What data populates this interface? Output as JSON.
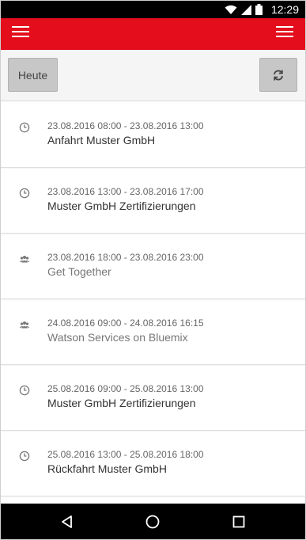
{
  "status": {
    "time": "12:29",
    "icons": [
      "wifi-icon",
      "signal-icon",
      "battery-icon"
    ]
  },
  "appbar": {
    "color": "#e30d1c",
    "left_icon": "hamburger-menu-icon",
    "right_icon": "hamburger-menu-icon"
  },
  "toolbar": {
    "today_label": "Heute",
    "refresh_icon": "refresh-icon"
  },
  "events": [
    {
      "range": "23.08.2016 08:00 - 23.08.2016 13:00",
      "title": "Anfahrt Muster GmbH",
      "icon": "clock-icon"
    },
    {
      "range": "23.08.2016 13:00 - 23.08.2016 17:00",
      "title": "Muster GmbH Zertifizierungen",
      "icon": "clock-icon"
    },
    {
      "range": "23.08.2016 18:00 - 23.08.2016 23:00",
      "title": "Get Together",
      "icon": "group-icon"
    },
    {
      "range": "24.08.2016 09:00 - 24.08.2016 16:15",
      "title": "Watson Services on Bluemix",
      "icon": "group-icon"
    },
    {
      "range": "25.08.2016 09:00 - 25.08.2016 13:00",
      "title": "Muster GmbH Zertifizierungen",
      "icon": "clock-icon"
    },
    {
      "range": "25.08.2016 13:00 - 25.08.2016 18:00",
      "title": "Rückfahrt Muster GmbH",
      "icon": "clock-icon"
    }
  ],
  "navbar": {
    "icons": [
      "back-icon",
      "home-icon",
      "recents-icon"
    ]
  }
}
